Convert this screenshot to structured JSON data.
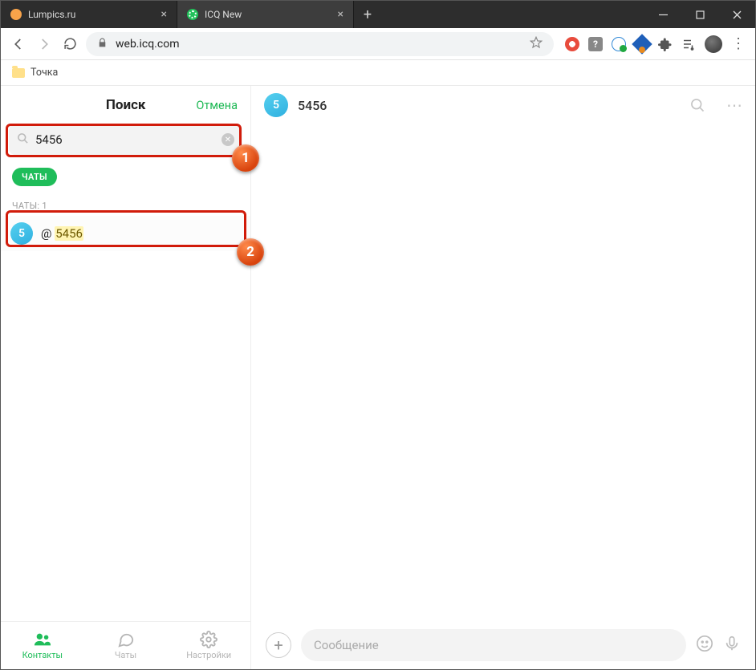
{
  "tabs": [
    {
      "label": "Lumpics.ru",
      "active": false
    },
    {
      "label": "ICQ New",
      "active": true
    }
  ],
  "address": {
    "host": "web.icq.com"
  },
  "bookmarks": [
    {
      "label": "Точка"
    }
  ],
  "sidebar": {
    "title": "Поиск",
    "cancel": "Отмена",
    "search_value": "5456",
    "filter_chip": "ЧАТЫ",
    "section_label": "ЧАТЫ: 1",
    "results": [
      {
        "avatar_initial": "5",
        "prefix": "@ ",
        "match": "5456"
      }
    ],
    "nav": {
      "contacts": "Контакты",
      "chats": "Чаты",
      "settings": "Настройки"
    }
  },
  "chat": {
    "avatar_initial": "5",
    "title": "5456",
    "message_placeholder": "Сообщение"
  },
  "annotations": {
    "b1": "1",
    "b2": "2"
  }
}
